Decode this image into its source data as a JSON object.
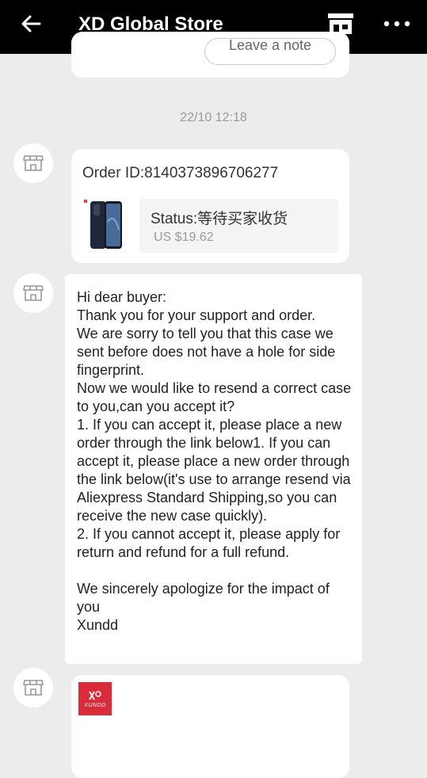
{
  "header": {
    "back_icon": "arrow-left-icon",
    "title": "XD Global Store",
    "store_icon": "store-icon",
    "more_icon": "more-horizontal-icon"
  },
  "top_card": {
    "leave_note_label": "Leave a note"
  },
  "timestamp": "22/10 12:18",
  "order": {
    "id_text": "Order ID:8140373896706277",
    "status_text": "Status:等待买家收货",
    "price_text": "US $19.62",
    "product_icon": "phone-case-thumbnail"
  },
  "message": {
    "text": "Hi dear buyer:\nThank you for your support and order.\nWe are sorry to tell you that this case we sent before does not have a hole for side fingerprint.\nNow we would like to resend a correct case to you,can you accept it?\n1. If you can accept it, please place a new order through the link below1. If you can accept it, please place a new order through the link below(it's use to arrange resend via Aliexpress Standard Shipping,so you can receive the new case quickly).\n2. If you cannot accept it, please apply for return and refund for a full refund.\n\nWe sincerely apologize for the impact of you\nXundd"
  },
  "logo_card": {
    "brand_name": "XUNDD",
    "brand_color": "#d92b3a"
  },
  "colors": {
    "header_bg": "#000000",
    "page_bg": "#ececec",
    "bubble_bg": "#ffffff",
    "muted_text": "#999999"
  }
}
